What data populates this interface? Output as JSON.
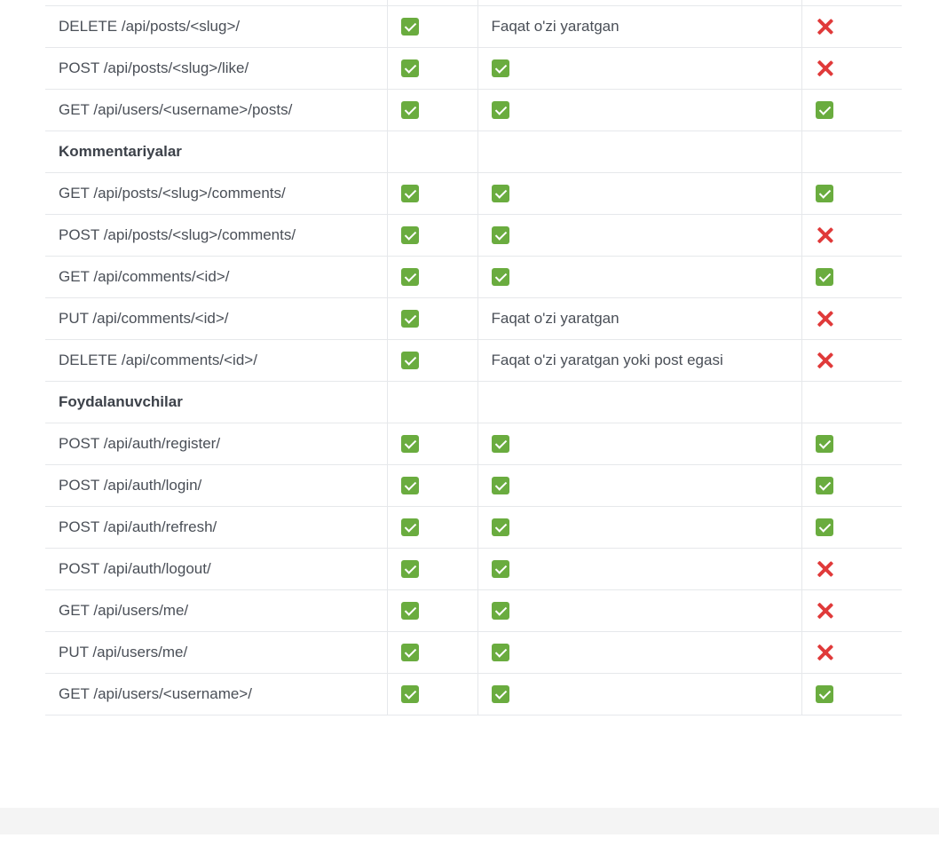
{
  "icons": {
    "yes": "check-mark-button-icon",
    "no": "cross-mark-icon"
  },
  "colors": {
    "check_green": "#6aac3f",
    "cross_red": "#e03a3a",
    "text": "#4a4f57",
    "border": "#e6e8eb",
    "footer": "#f4f4f4"
  },
  "rows": [
    {
      "endpoint": "DELETE /api/posts/<slug>/",
      "c2": "yes",
      "c3_text": "Faqat o'zi yaratgan",
      "c4": "no"
    },
    {
      "endpoint": "POST /api/posts/<slug>/like/",
      "c2": "yes",
      "c3": "yes",
      "c4": "no"
    },
    {
      "endpoint": "GET /api/users/<username>/posts/",
      "c2": "yes",
      "c3": "yes",
      "c4": "yes"
    },
    {
      "section": "Kommentariyalar"
    },
    {
      "endpoint": "GET /api/posts/<slug>/comments/",
      "c2": "yes",
      "c3": "yes",
      "c4": "yes"
    },
    {
      "endpoint": "POST /api/posts/<slug>/comments/",
      "c2": "yes",
      "c3": "yes",
      "c4": "no"
    },
    {
      "endpoint": "GET /api/comments/<id>/",
      "c2": "yes",
      "c3": "yes",
      "c4": "yes"
    },
    {
      "endpoint": "PUT /api/comments/<id>/",
      "c2": "yes",
      "c3_text": "Faqat o'zi yaratgan",
      "c4": "no"
    },
    {
      "endpoint": "DELETE /api/comments/<id>/",
      "c2": "yes",
      "c3_text": "Faqat o'zi yaratgan yoki post egasi",
      "c4": "no"
    },
    {
      "section": "Foydalanuvchilar"
    },
    {
      "endpoint": "POST /api/auth/register/",
      "c2": "yes",
      "c3": "yes",
      "c4": "yes"
    },
    {
      "endpoint": "POST /api/auth/login/",
      "c2": "yes",
      "c3": "yes",
      "c4": "yes"
    },
    {
      "endpoint": "POST /api/auth/refresh/",
      "c2": "yes",
      "c3": "yes",
      "c4": "yes"
    },
    {
      "endpoint": "POST /api/auth/logout/",
      "c2": "yes",
      "c3": "yes",
      "c4": "no"
    },
    {
      "endpoint": "GET /api/users/me/",
      "c2": "yes",
      "c3": "yes",
      "c4": "no"
    },
    {
      "endpoint": "PUT /api/users/me/",
      "c2": "yes",
      "c3": "yes",
      "c4": "no"
    },
    {
      "endpoint": "GET /api/users/<username>/",
      "c2": "yes",
      "c3": "yes",
      "c4": "yes"
    }
  ]
}
